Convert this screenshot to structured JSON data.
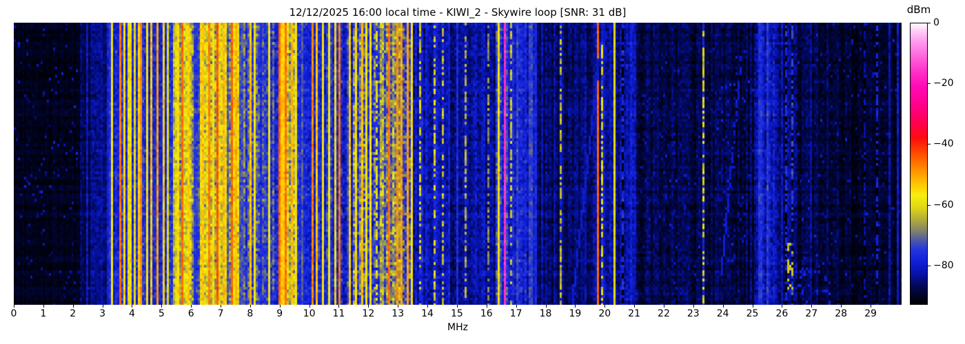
{
  "chart_data": {
    "type": "heatmap",
    "subtype": "radio-spectrogram-waterfall",
    "title": "12/12/2025 16:00 local time - KIWI_2 - Skywire loop [SNR: 31 dB]",
    "xlabel": "MHz",
    "xlim": [
      0,
      30.05
    ],
    "x_ticks": [
      0,
      1,
      2,
      3,
      4,
      5,
      6,
      7,
      8,
      9,
      10,
      11,
      12,
      13,
      14,
      15,
      16,
      17,
      18,
      19,
      20,
      21,
      22,
      23,
      24,
      25,
      26,
      27,
      28,
      29
    ],
    "grid": false,
    "colorbar": {
      "label": "dBm",
      "ticks": [
        0,
        -20,
        -40,
        -60,
        -80
      ],
      "tick_labels": [
        "0",
        "−20",
        "−40",
        "−60",
        "−80"
      ],
      "range": [
        0,
        -93
      ],
      "stops": [
        [
          0,
          "#ffffff"
        ],
        [
          -2,
          "#ffd6f8"
        ],
        [
          -6,
          "#ff9cee"
        ],
        [
          -11,
          "#ff64dc"
        ],
        [
          -16,
          "#ff30c8"
        ],
        [
          -21,
          "#ff0ab4"
        ],
        [
          -27,
          "#ff008c"
        ],
        [
          -33,
          "#fe0050"
        ],
        [
          -38,
          "#fb0d0d"
        ],
        [
          -43,
          "#ff4a00"
        ],
        [
          -48,
          "#ff8800"
        ],
        [
          -53,
          "#ffc300"
        ],
        [
          -57,
          "#f7ef0c"
        ],
        [
          -61,
          "#dfd714"
        ],
        [
          -65,
          "#b2ab3c"
        ],
        [
          -69,
          "#7d7f6e"
        ],
        [
          -72,
          "#4b56a8"
        ],
        [
          -75,
          "#2334de"
        ],
        [
          -79,
          "#101fd8"
        ],
        [
          -83,
          "#0612a8"
        ],
        [
          -87,
          "#020858"
        ],
        [
          -90,
          "#010428"
        ],
        [
          -93,
          "#000000"
        ]
      ]
    },
    "bands": [
      {
        "f0": 0.0,
        "f1": 2.3,
        "base": -91,
        "var": 1.6
      },
      {
        "f0": 2.3,
        "f1": 2.62,
        "base": -88,
        "var": 3
      },
      {
        "f0": 2.62,
        "f1": 3.22,
        "base": -85,
        "var": 4
      },
      {
        "f0": 3.22,
        "f1": 5.42,
        "base": -78,
        "var": 6
      },
      {
        "f0": 5.42,
        "f1": 6.06,
        "base": -64,
        "var": 8
      },
      {
        "f0": 6.06,
        "f1": 6.32,
        "base": -76,
        "var": 6
      },
      {
        "f0": 6.32,
        "f1": 7.66,
        "base": -62,
        "var": 9
      },
      {
        "f0": 7.66,
        "f1": 8.32,
        "base": -73,
        "var": 8
      },
      {
        "f0": 8.32,
        "f1": 9.0,
        "base": -75,
        "var": 7
      },
      {
        "f0": 9.0,
        "f1": 9.6,
        "base": -64,
        "var": 9
      },
      {
        "f0": 9.6,
        "f1": 10.16,
        "base": -76,
        "var": 6
      },
      {
        "f0": 10.16,
        "f1": 11.5,
        "base": -77,
        "var": 7
      },
      {
        "f0": 11.5,
        "f1": 13.45,
        "base": -71,
        "var": 10
      },
      {
        "f0": 13.45,
        "f1": 14.45,
        "base": -81,
        "var": 6
      },
      {
        "f0": 14.45,
        "f1": 16.3,
        "base": -84,
        "var": 5
      },
      {
        "f0": 16.3,
        "f1": 16.75,
        "base": -76,
        "var": 7
      },
      {
        "f0": 16.75,
        "f1": 17.7,
        "base": -80,
        "var": 6
      },
      {
        "f0": 17.7,
        "f1": 19.6,
        "base": -86,
        "var": 4
      },
      {
        "f0": 19.6,
        "f1": 21.1,
        "base": -84,
        "var": 5
      },
      {
        "f0": 21.1,
        "f1": 25.05,
        "base": -88.5,
        "var": 3.5
      },
      {
        "f0": 25.05,
        "f1": 25.75,
        "base": -81,
        "var": 6
      },
      {
        "f0": 25.75,
        "f1": 26.55,
        "base": -85,
        "var": 5
      },
      {
        "f0": 26.55,
        "f1": 28.0,
        "base": -88.5,
        "var": 3.5
      },
      {
        "f0": 28.0,
        "f1": 30.05,
        "base": -90,
        "var": 2.5
      }
    ],
    "carriers": [
      {
        "f": 2.26,
        "hw": 0.02,
        "level": -86
      },
      {
        "f": 2.47,
        "hw": 0.025,
        "level": -81
      },
      {
        "f": 2.84,
        "hw": 0.02,
        "level": -84
      },
      {
        "f": 3.18,
        "hw": 0.03,
        "level": -79
      },
      {
        "f": 3.27,
        "hw": 0.04,
        "level": -76
      },
      {
        "f": 3.35,
        "hw": 0.03,
        "level": -58
      },
      {
        "f": 3.57,
        "hw": 0.035,
        "level": -46,
        "var": 3
      },
      {
        "f": 3.73,
        "hw": 0.03,
        "level": -56
      },
      {
        "f": 3.88,
        "hw": 0.03,
        "level": -60
      },
      {
        "f": 3.97,
        "hw": 0.03,
        "level": -55
      },
      {
        "f": 4.1,
        "hw": 0.03,
        "level": -60
      },
      {
        "f": 4.21,
        "hw": 0.03,
        "level": -54
      },
      {
        "f": 4.33,
        "hw": 0.03,
        "level": -48,
        "var": 3
      },
      {
        "f": 4.5,
        "hw": 0.03,
        "level": -57
      },
      {
        "f": 4.67,
        "hw": 0.035,
        "level": -53
      },
      {
        "f": 4.86,
        "hw": 0.035,
        "level": -50
      },
      {
        "f": 5.06,
        "hw": 0.035,
        "level": -54
      },
      {
        "f": 5.2,
        "hw": 0.03,
        "level": -60
      },
      {
        "f": 5.32,
        "hw": 0.03,
        "level": -56
      },
      {
        "f": 5.56,
        "hw": 0.05,
        "level": -55
      },
      {
        "f": 5.67,
        "hw": 0.03,
        "level": -74
      },
      {
        "f": 5.73,
        "hw": 0.035,
        "level": -45,
        "var": 3
      },
      {
        "f": 5.9,
        "hw": 0.05,
        "level": -54
      },
      {
        "f": 6.13,
        "hw": 0.06,
        "level": -75
      },
      {
        "f": 6.42,
        "hw": 0.04,
        "level": -53
      },
      {
        "f": 6.6,
        "hw": 0.04,
        "level": -47,
        "var": 3
      },
      {
        "f": 6.78,
        "hw": 0.03,
        "level": -56
      },
      {
        "f": 6.92,
        "hw": 0.035,
        "level": -44,
        "var": 3
      },
      {
        "f": 7.1,
        "hw": 0.04,
        "level": -52
      },
      {
        "f": 7.24,
        "hw": 0.03,
        "level": -72
      },
      {
        "f": 7.36,
        "hw": 0.035,
        "level": -45,
        "var": 3
      },
      {
        "f": 7.5,
        "hw": 0.04,
        "level": -52
      },
      {
        "f": 7.7,
        "hw": 0.05,
        "level": -73
      },
      {
        "f": 7.84,
        "hw": 0.03,
        "level": -56
      },
      {
        "f": 8.0,
        "hw": 0.035,
        "level": -53
      },
      {
        "f": 8.17,
        "hw": 0.03,
        "level": -58
      },
      {
        "f": 8.35,
        "hw": 0.05,
        "level": -77
      },
      {
        "f": 8.47,
        "hw": 0.03,
        "level": -56
      },
      {
        "f": 8.66,
        "hw": 0.03,
        "level": -58
      },
      {
        "f": 8.99,
        "hw": 0.035,
        "level": -45,
        "var": 3
      },
      {
        "f": 9.1,
        "hw": 0.04,
        "level": -54
      },
      {
        "f": 9.22,
        "hw": 0.035,
        "level": -46,
        "var": 3
      },
      {
        "f": 9.4,
        "hw": 0.04,
        "level": -52
      },
      {
        "f": 9.53,
        "hw": 0.03,
        "level": -57
      },
      {
        "f": 9.75,
        "hw": 0.03,
        "level": -72
      },
      {
        "f": 10.12,
        "hw": 0.035,
        "level": -48,
        "var": 4
      },
      {
        "f": 10.25,
        "hw": 0.03,
        "level": -53
      },
      {
        "f": 10.45,
        "hw": 0.03,
        "level": -58
      },
      {
        "f": 10.68,
        "hw": 0.03,
        "level": -57
      },
      {
        "f": 10.9,
        "hw": 0.035,
        "level": -55
      },
      {
        "f": 11.0,
        "hw": 0.03,
        "level": -46,
        "var": 4
      },
      {
        "f": 11.35,
        "hw": 0.035,
        "level": -54
      },
      {
        "f": 11.6,
        "hw": 0.035,
        "level": -56
      },
      {
        "f": 11.8,
        "hw": 0.035,
        "level": -53
      },
      {
        "f": 11.95,
        "hw": 0.03,
        "level": -58
      },
      {
        "f": 12.1,
        "hw": 0.03,
        "level": -56
      },
      {
        "f": 12.28,
        "hw": 0.03,
        "level": -60,
        "dash": 1
      },
      {
        "f": 12.68,
        "hw": 0.04,
        "level": -46,
        "var": 3
      },
      {
        "f": 12.95,
        "hw": 0.035,
        "level": -49
      },
      {
        "f": 13.1,
        "hw": 0.04,
        "level": -50,
        "var": 4
      },
      {
        "f": 13.3,
        "hw": 0.035,
        "level": -50,
        "var": 3
      },
      {
        "f": 13.45,
        "hw": 0.03,
        "level": -56
      },
      {
        "f": 13.58,
        "hw": 0.03,
        "level": -58,
        "dash": 1
      },
      {
        "f": 13.76,
        "hw": 0.03,
        "level": -62,
        "dash": 1
      },
      {
        "f": 14.0,
        "hw": 0.03,
        "level": -64,
        "dash": 1
      },
      {
        "f": 14.22,
        "hw": 0.03,
        "level": -61,
        "dash": 1
      },
      {
        "f": 14.55,
        "hw": 0.03,
        "level": -63,
        "dash": 1
      },
      {
        "f": 14.75,
        "hw": 0.02,
        "level": -79
      },
      {
        "f": 15.0,
        "hw": 0.02,
        "level": -77
      },
      {
        "f": 15.3,
        "hw": 0.025,
        "level": -65,
        "dash": 1
      },
      {
        "f": 15.62,
        "hw": 0.02,
        "level": -78
      },
      {
        "f": 15.9,
        "hw": 0.02,
        "level": -80
      },
      {
        "f": 16.05,
        "hw": 0.025,
        "level": -68,
        "dash": 1
      },
      {
        "f": 16.4,
        "hw": 0.05,
        "level": -58,
        "var": 6
      },
      {
        "f": 16.52,
        "hw": 0.03,
        "level": -50,
        "var": 4,
        "dash": 1
      },
      {
        "f": 16.62,
        "hw": 0.04,
        "level": -16,
        "var": 3
      },
      {
        "f": 16.85,
        "hw": 0.03,
        "level": -63,
        "dash": 1
      },
      {
        "f": 17.05,
        "hw": 0.03,
        "level": -74
      },
      {
        "f": 17.22,
        "hw": 0.03,
        "level": -76
      },
      {
        "f": 17.48,
        "hw": 0.06,
        "level": -74
      },
      {
        "f": 17.65,
        "hw": 0.03,
        "level": -77
      },
      {
        "f": 17.9,
        "hw": 0.02,
        "level": -82
      },
      {
        "f": 18.3,
        "hw": 0.02,
        "level": -83
      },
      {
        "f": 18.5,
        "hw": 0.025,
        "level": -64,
        "dash": 1
      },
      {
        "f": 18.7,
        "hw": 0.02,
        "level": -83
      },
      {
        "f": 19.05,
        "hw": 0.02,
        "level": -82
      },
      {
        "f": 19.35,
        "hw": 0.02,
        "level": -83
      },
      {
        "f": 19.78,
        "hw": 0.035,
        "level": -45,
        "var": 2
      },
      {
        "f": 19.9,
        "hw": 0.025,
        "level": -60,
        "dash": 1
      },
      {
        "f": 20.1,
        "hw": 0.02,
        "level": -80
      },
      {
        "f": 20.35,
        "hw": 0.02,
        "level": -60,
        "var": 2
      },
      {
        "f": 20.62,
        "hw": 0.03,
        "level": -77,
        "dash": 1
      },
      {
        "f": 20.9,
        "hw": 0.03,
        "level": -79
      },
      {
        "f": 21.45,
        "hw": 0.02,
        "level": -86
      },
      {
        "f": 22.3,
        "hw": 0.02,
        "level": -86
      },
      {
        "f": 23.33,
        "hw": 0.03,
        "level": -61,
        "dash": 1
      },
      {
        "f": 24.95,
        "hw": 0.02,
        "level": -85
      },
      {
        "f": 25.25,
        "hw": 0.07,
        "level": -76,
        "var": 4
      },
      {
        "f": 25.52,
        "hw": 0.06,
        "level": -75,
        "var": 4
      },
      {
        "f": 25.9,
        "hw": 0.02,
        "level": -84
      },
      {
        "f": 26.15,
        "hw": 0.035,
        "level": -77,
        "dash": 1
      },
      {
        "f": 26.38,
        "hw": 0.035,
        "level": -74,
        "dash": 1
      },
      {
        "f": 27.0,
        "hw": 0.02,
        "level": -84
      },
      {
        "f": 28.5,
        "hw": 0.02,
        "level": -88
      },
      {
        "f": 28.82,
        "hw": 0.02,
        "level": -84,
        "dash": 1
      },
      {
        "f": 29.25,
        "hw": 0.03,
        "level": -78,
        "dash": 1
      },
      {
        "f": 29.65,
        "hw": 0.02,
        "level": -83
      },
      {
        "f": 29.9,
        "hw": 0.025,
        "level": -80
      }
    ],
    "diagonals": [
      {
        "f0": 18.9,
        "y0": 1.0,
        "f1": 19.95,
        "y1": 0.0,
        "level": -80,
        "dash": 0
      },
      {
        "f0": 23.95,
        "y0": 0.9,
        "f1": 24.65,
        "y1": 0.1,
        "level": -80,
        "dash": 1
      }
    ],
    "patches": [
      {
        "f0": 26.5,
        "f1": 27.6,
        "y0": 0.82,
        "y1": 1.0,
        "density": 0.1,
        "level": -79
      },
      {
        "f0": 23.9,
        "f1": 24.8,
        "y0": 0.1,
        "y1": 0.9,
        "density": 0.025,
        "level": -80
      },
      {
        "f0": 21.2,
        "f1": 23.0,
        "y0": 0.0,
        "y1": 1.0,
        "density": 0.01,
        "level": -82
      },
      {
        "f0": 26.2,
        "f1": 26.35,
        "y0": 0.78,
        "y1": 0.95,
        "density": 0.25,
        "level": -63
      }
    ]
  }
}
